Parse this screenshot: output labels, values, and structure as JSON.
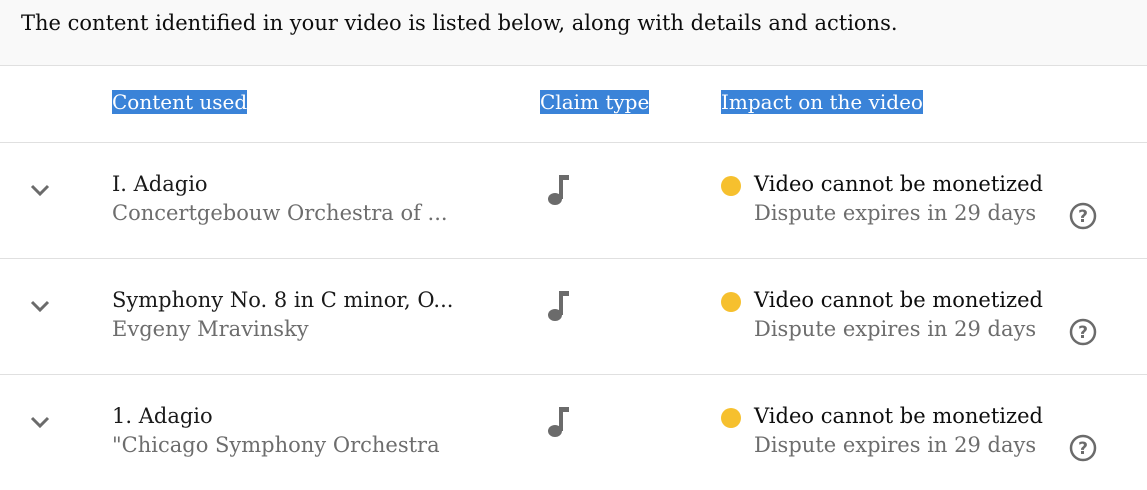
{
  "banner": {
    "text": "The content identified in your video is listed below, along with details and actions."
  },
  "columns": {
    "content": "Content used",
    "claim": "Claim type",
    "impact": "Impact on the video"
  },
  "colors": {
    "header_highlight": "#3a83d8",
    "status_dot": "#f6c02e",
    "icon": "#6b6b6b"
  },
  "rows": [
    {
      "title": "I. Adagio",
      "subtitle": "Concertgebouw Orchestra of ...",
      "claim_icon": "music-note-icon",
      "impact": "Video cannot be monetized",
      "dispute": "Dispute expires in 29 days"
    },
    {
      "title": "Symphony No. 8 in C minor, O...",
      "subtitle": "Evgeny Mravinsky",
      "claim_icon": "music-note-icon",
      "impact": "Video cannot be monetized",
      "dispute": "Dispute expires in 29 days"
    },
    {
      "title": "1. Adagio",
      "subtitle": "\"Chicago Symphony Orchestra",
      "claim_icon": "music-note-icon",
      "impact": "Video cannot be monetized",
      "dispute": "Dispute expires in 29 days"
    }
  ]
}
